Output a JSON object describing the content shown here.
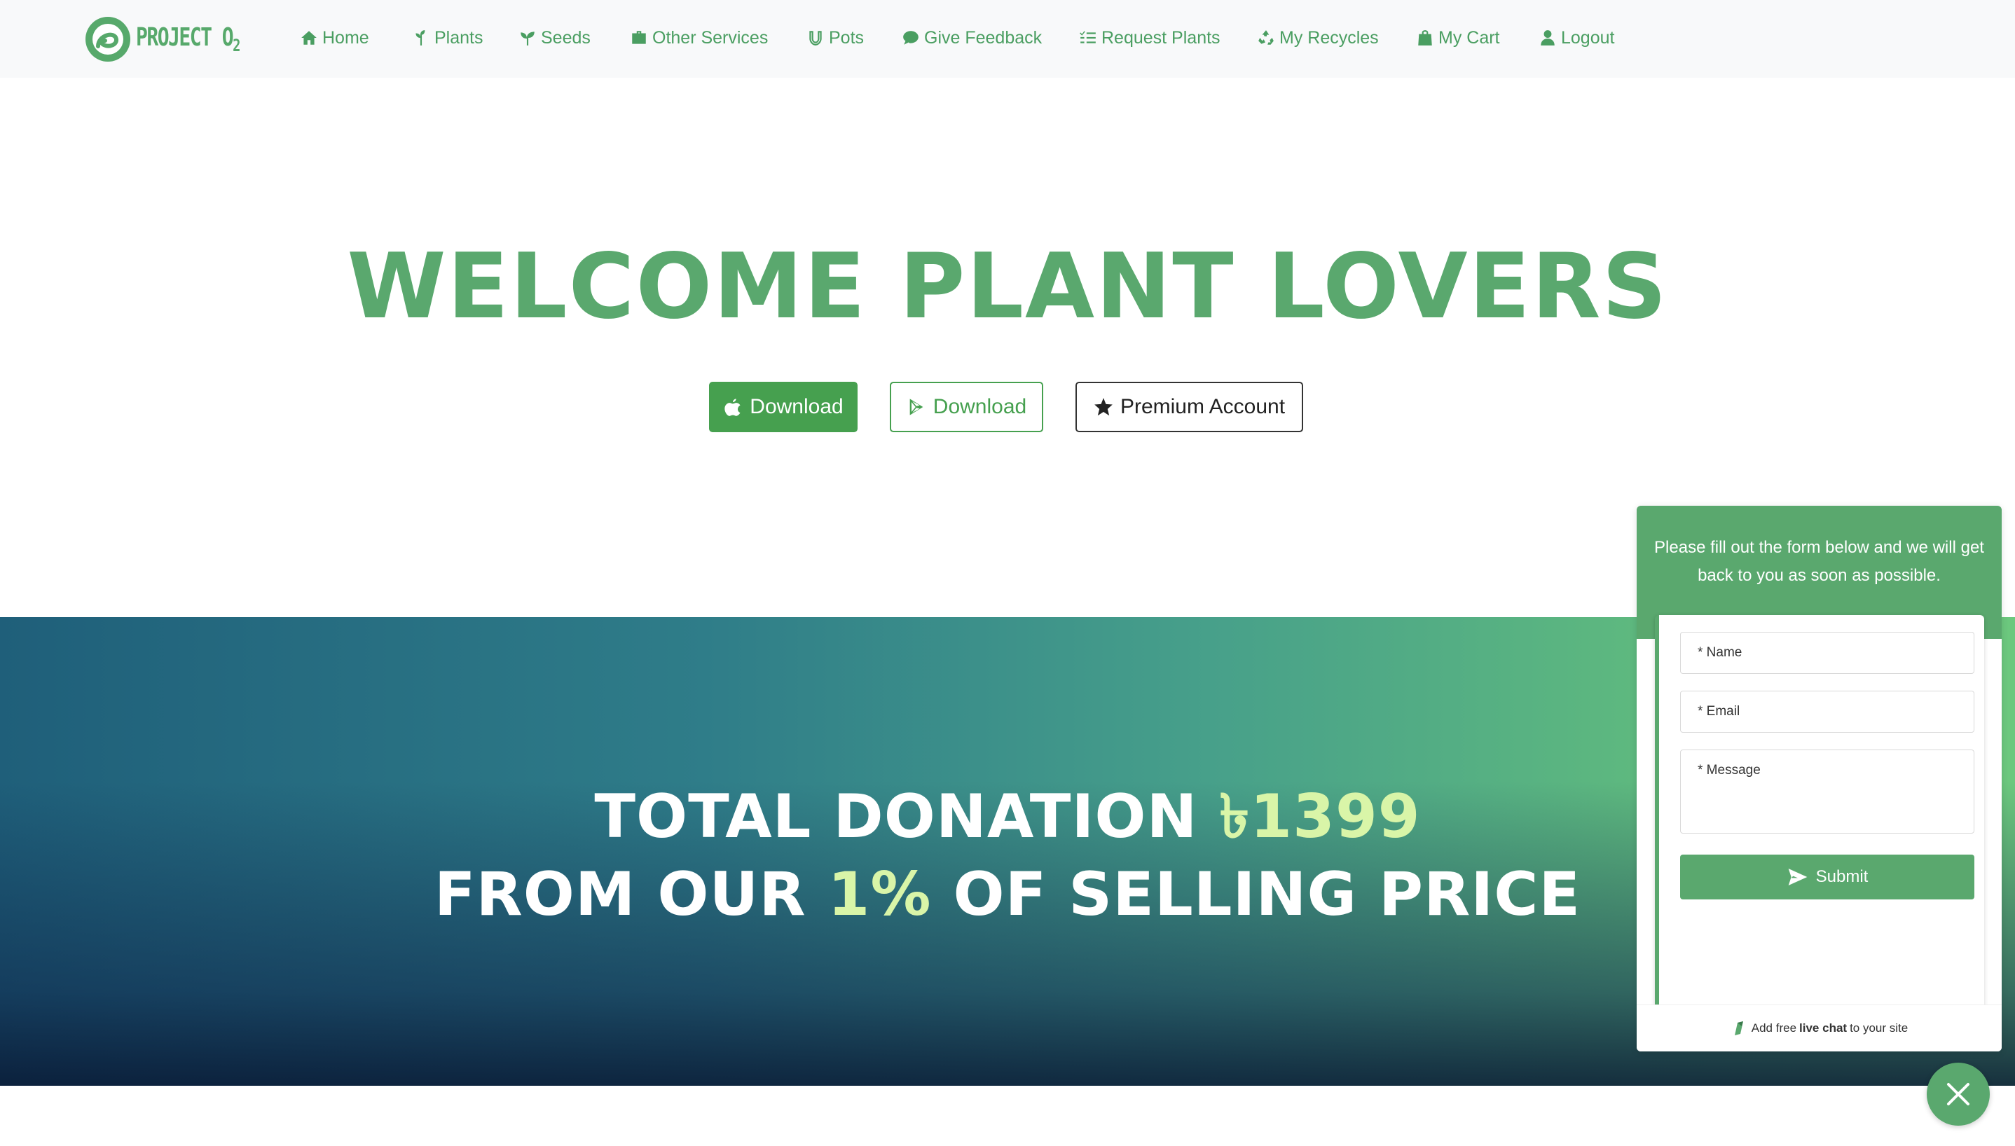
{
  "brand": {
    "name": "PROJECT O",
    "subscript": "2"
  },
  "nav": {
    "home": "Home",
    "plants": "Plants",
    "seeds": "Seeds",
    "other_services": "Other Services",
    "pots": "Pots",
    "feedback": "Give Feedback",
    "request": "Request Plants",
    "recycles": "My Recycles",
    "cart": "My Cart",
    "logout": "Logout"
  },
  "hero": {
    "title": "WELCOME PLANT LOVERS",
    "apple_button": "Download",
    "play_button": "Download",
    "premium_button": "Premium Account"
  },
  "donation": {
    "line1_prefix": "TOTAL DONATION ",
    "amount": "৳1399",
    "line2_prefix": "FROM OUR ",
    "percent": "1%",
    "line2_suffix": " OF SELLING PRICE"
  },
  "chat": {
    "message": "Please fill out the form below and we will get back to you as soon as possible.",
    "name_placeholder": "* Name",
    "email_placeholder": "* Email",
    "message_placeholder": "* Message",
    "submit": "Submit",
    "footer_prefix": "Add free",
    "footer_bold": "live chat",
    "footer_suffix": "to your site"
  },
  "colors": {
    "accent": "#5aa86e",
    "button_green": "#46a04f",
    "highlight": "#d9f5a8"
  }
}
